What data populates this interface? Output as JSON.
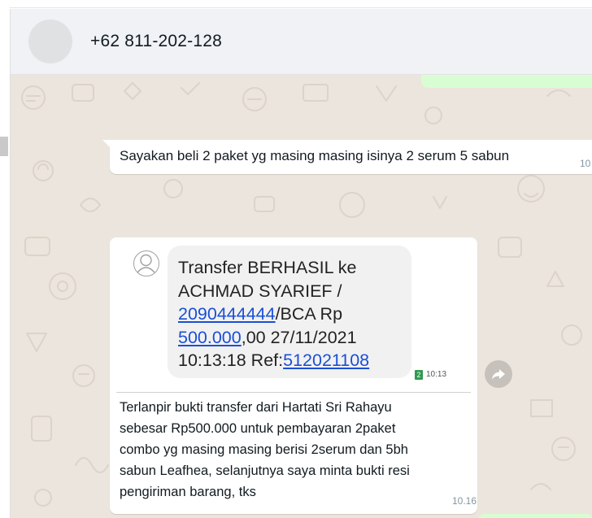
{
  "header": {
    "contact_name": "+62 811-202-128"
  },
  "messages": [
    {
      "text": "Sayakan beli 2 paket yg masing masing isinya 2 serum 5 sabun",
      "time": "10"
    },
    {
      "attachment": {
        "sms_lines": [
          "Transfer BERHASIL ke",
          "ACHMAD SYARIEF /"
        ],
        "account_number": "2090444444",
        "account_suffix": "/BCA Rp",
        "amount": "500.000",
        "amount_suffix": ",00 27/11/2021",
        "time_prefix": "10:13:18 Ref:",
        "ref": "512021108",
        "sim_badge": "2",
        "sms_time": "10:13"
      },
      "caption_lines": [
        "Terlanpir bukti transfer dari Hartati Sri Rahayu",
        "sebesar Rp500.000 untuk pembayaran 2paket",
        "combo yg masing masing berisi 2serum dan 5bh",
        "sabun Leafhea, selanjutnya saya minta bukti resi",
        "pengiriman barang, tks"
      ],
      "time": "10.16"
    }
  ],
  "icons": {
    "avatar": "contact-avatar",
    "forward": "forward-icon",
    "sms_avatar": "person-icon"
  },
  "colors": {
    "chat_background": "#ece5dd",
    "outgoing_bubble": "#d9fdd3",
    "incoming_bubble": "#ffffff",
    "link": "#1a4fd6"
  }
}
